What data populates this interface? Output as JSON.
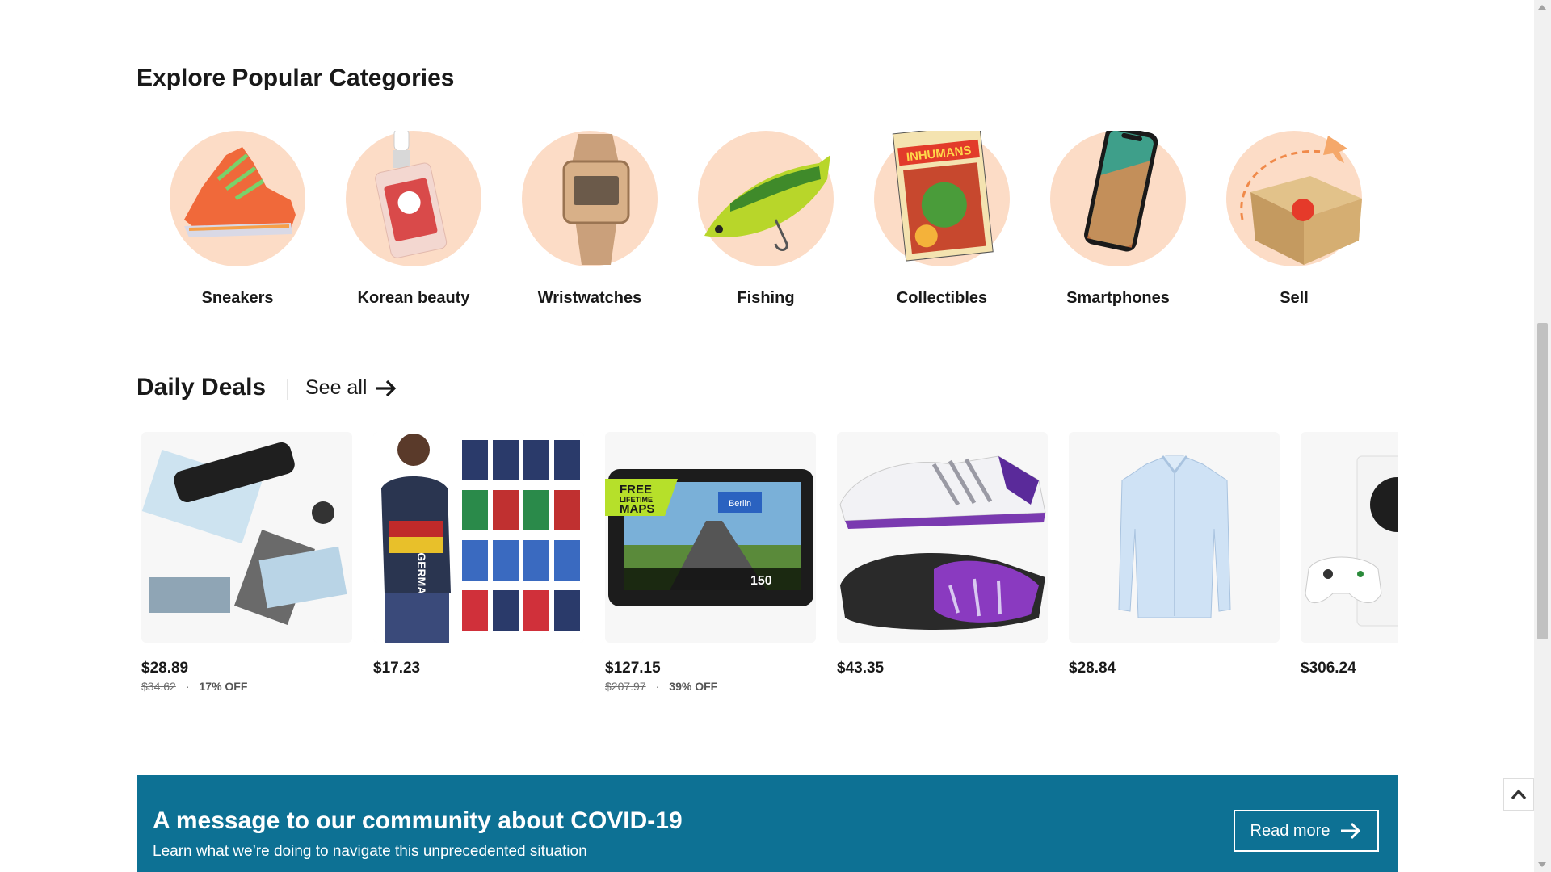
{
  "categories": {
    "title": "Explore Popular Categories",
    "items": [
      {
        "label": "Sneakers",
        "icon": "sneaker-image"
      },
      {
        "label": "Korean beauty",
        "icon": "serum-bottle-image"
      },
      {
        "label": "Wristwatches",
        "icon": "wristwatch-image"
      },
      {
        "label": "Fishing",
        "icon": "fishing-lure-image"
      },
      {
        "label": "Collectibles",
        "icon": "comic-book-image"
      },
      {
        "label": "Smartphones",
        "icon": "smartphone-image"
      },
      {
        "label": "Sell",
        "icon": "parcel-box-image"
      }
    ],
    "circle_color": "#fcdcc6"
  },
  "deals": {
    "title": "Daily Deals",
    "see_all": "See all",
    "items": [
      {
        "image": "laminator-image",
        "price": "$28.89",
        "original": "$34.62",
        "off": "17% OFF"
      },
      {
        "image": "germany-shirt-image",
        "price": "$17.23",
        "original": "",
        "off": ""
      },
      {
        "image": "gps-navigator-image",
        "price": "$127.15",
        "original": "$207.97",
        "off": "39% OFF"
      },
      {
        "image": "running-shoes-image",
        "price": "$43.35",
        "original": "",
        "off": ""
      },
      {
        "image": "dress-shirt-image",
        "price": "$28.84",
        "original": "",
        "off": ""
      },
      {
        "image": "game-console-image",
        "price": "$306.24",
        "original": "",
        "off": ""
      }
    ],
    "gps_badge": [
      "FREE",
      "LIFETIME",
      "MAPS"
    ],
    "gps_sign": "Berlin",
    "gps_distance": "150",
    "shirt_text": "GERMANY",
    "comic_title": "INHUMANS"
  },
  "banner": {
    "title": "A message to our community about COVID-19",
    "subtitle": "Learn what we’re doing to navigate this unprecedented situation",
    "button": "Read more",
    "color": "#0d7194"
  }
}
